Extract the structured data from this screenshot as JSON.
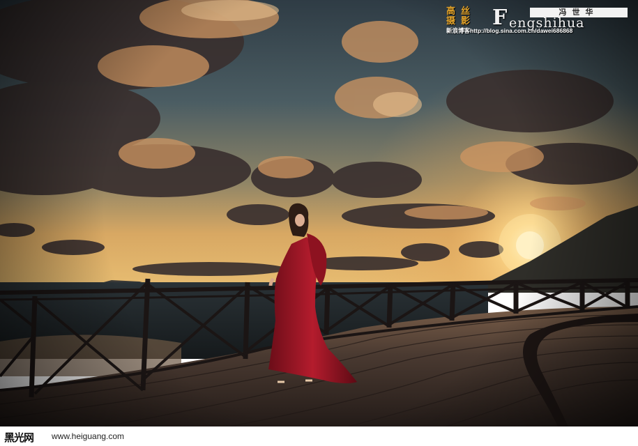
{
  "photo": {
    "subject": "woman-in-red-gown",
    "colors": {
      "sky_top": "#3a4a52",
      "sky_horizon": "#e9b86a",
      "sun": "#fff4c2",
      "cloud_dark": "#3b3132",
      "cloud_lit": "#c98d5a",
      "sea": "#1d2226",
      "boardwalk": "#3d2f29",
      "railing": "#1b1514",
      "gown": "#9e1626",
      "hills": "#2b2b27"
    }
  },
  "watermark": {
    "chars_left": "高丝摄影",
    "big_letter": "F",
    "cn_name": "冯世华",
    "roman_name": "engshihua",
    "blog_line": "新浪博客http://blog.sina.com.cn/dawei686868"
  },
  "footer": {
    "site_logo": "黑光网",
    "site_url": "www.heiguang.com"
  }
}
